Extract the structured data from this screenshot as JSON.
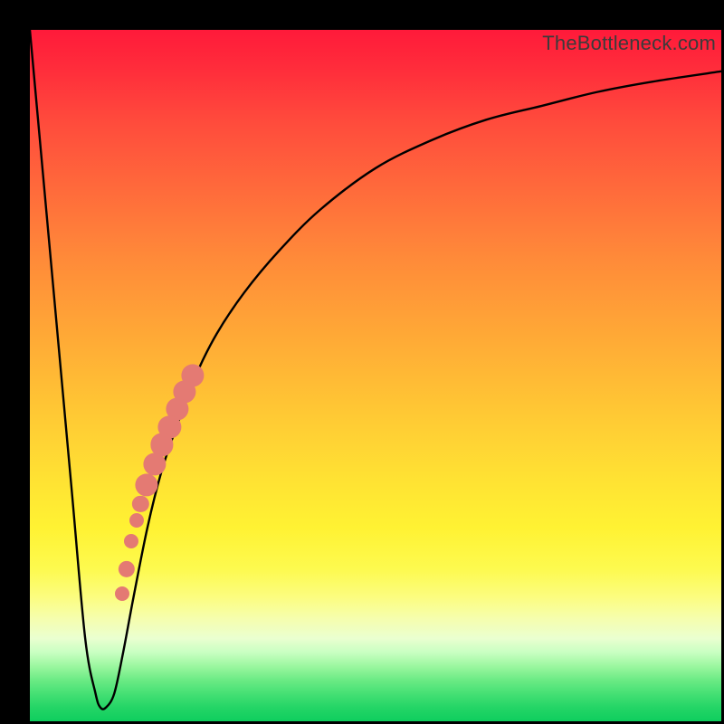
{
  "watermark": "TheBottleneck.com",
  "colors": {
    "frame": "#000000",
    "curve": "#000000",
    "dots": "#e47a73"
  },
  "chart_data": {
    "type": "line",
    "title": "",
    "xlabel": "",
    "ylabel": "",
    "xlim": [
      0,
      100
    ],
    "ylim": [
      0,
      100
    ],
    "grid": false,
    "legend": false,
    "annotations": [
      "TheBottleneck.com"
    ],
    "series": [
      {
        "name": "bottleneck-curve",
        "x": [
          0,
          3,
          6,
          8,
          9.5,
          10.2,
          11,
          12.2,
          13.5,
          15,
          17,
          19,
          21,
          24,
          27,
          31,
          36,
          42,
          50,
          58,
          66,
          74,
          82,
          90,
          100
        ],
        "y": [
          100,
          67,
          34,
          12,
          4,
          2,
          2,
          4,
          10,
          18,
          28,
          36,
          42,
          50,
          56,
          62,
          68,
          74,
          80,
          84,
          87,
          89,
          91,
          92.5,
          94
        ]
      }
    ],
    "markers": [
      {
        "name": "bar-top",
        "x": 23.5,
        "y": 50,
        "r_pct": 1.65
      },
      {
        "name": "bar-upper",
        "x": 22.4,
        "y": 47.7,
        "r_pct": 1.65
      },
      {
        "name": "bar-mid1",
        "x": 21.3,
        "y": 45.2,
        "r_pct": 1.65
      },
      {
        "name": "bar-mid2",
        "x": 20.2,
        "y": 42.6,
        "r_pct": 1.65
      },
      {
        "name": "bar-mid3",
        "x": 19.1,
        "y": 40.0,
        "r_pct": 1.65
      },
      {
        "name": "bar-mid4",
        "x": 18.0,
        "y": 37.2,
        "r_pct": 1.65
      },
      {
        "name": "bar-low1",
        "x": 16.9,
        "y": 34.2,
        "r_pct": 1.65
      },
      {
        "name": "dot-gap1",
        "x": 16.0,
        "y": 31.4,
        "r_pct": 1.2
      },
      {
        "name": "dot-gap2",
        "x": 15.4,
        "y": 29.0,
        "r_pct": 1.05
      },
      {
        "name": "dot-gap3",
        "x": 14.7,
        "y": 26.0,
        "r_pct": 1.05
      },
      {
        "name": "dot-gap4",
        "x": 14.0,
        "y": 22.0,
        "r_pct": 1.2
      },
      {
        "name": "dot-bottom",
        "x": 13.4,
        "y": 18.4,
        "r_pct": 1.05
      }
    ]
  }
}
